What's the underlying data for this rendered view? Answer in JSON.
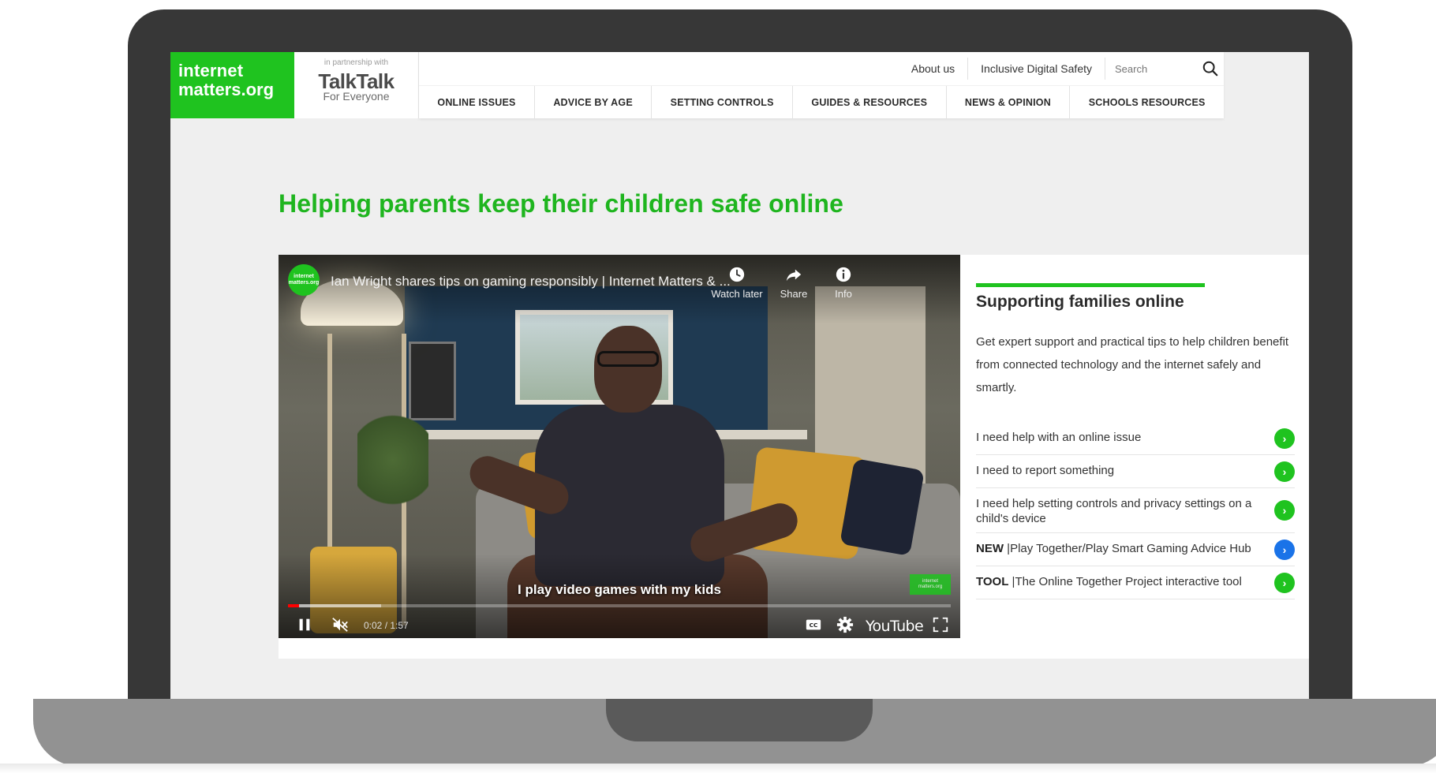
{
  "header": {
    "logo_line1": "internet",
    "logo_line2": "matters.org",
    "partner_note": "in partnership with",
    "partner_brand": "TalkTalk",
    "partner_tag": "For Everyone",
    "top_links": [
      "About us",
      "Inclusive Digital Safety"
    ],
    "search_placeholder": "Search",
    "nav": [
      "ONLINE ISSUES",
      "ADVICE BY AGE",
      "SETTING CONTROLS",
      "GUIDES & RESOURCES",
      "NEWS & OPINION",
      "SCHOOLS RESOURCES"
    ]
  },
  "hero": {
    "title": "Helping parents keep their children safe online"
  },
  "video": {
    "channel_badge": "internet matters.org",
    "title": "Ian Wright shares tips on gaming responsibly | Internet Matters & ...",
    "watch_later": "Watch later",
    "share": "Share",
    "info": "Info",
    "subtitle": "I play video games with my kids",
    "watermark": "internet matters.org",
    "time": "0:02 / 1:57",
    "progress_fraction": 0.017,
    "buffer_fraction": 0.14,
    "youtube_label": "YouTube"
  },
  "side": {
    "heading": "Supporting families online",
    "description": "Get expert support and practical tips to help children benefit from connected technology and the internet safely and smartly.",
    "links": [
      {
        "prefix": "",
        "text": "I need help with an online issue",
        "color": "green"
      },
      {
        "prefix": "",
        "text": "I need to report something",
        "color": "green"
      },
      {
        "prefix": "",
        "text": "I need help setting controls and privacy settings on a child's device",
        "color": "green"
      },
      {
        "prefix": "NEW",
        "text": " |Play Together/Play Smart Gaming Advice Hub",
        "color": "blue"
      },
      {
        "prefix": "TOOL",
        "text": " |The Online Together Project interactive tool",
        "color": "green"
      }
    ]
  },
  "colors": {
    "brand_green": "#1fc31f",
    "accent_blue": "#1a73e8",
    "laptop_frame": "#373737",
    "laptop_base": "#929292"
  },
  "icons": {
    "search": "search-icon",
    "chevron": "chevron-right-icon",
    "clock": "clock-icon",
    "share": "share-icon",
    "info": "info-icon",
    "pause": "pause-icon",
    "mute": "mute-icon",
    "captions": "captions-icon",
    "settings": "gear-icon",
    "fullscreen": "fullscreen-icon"
  }
}
